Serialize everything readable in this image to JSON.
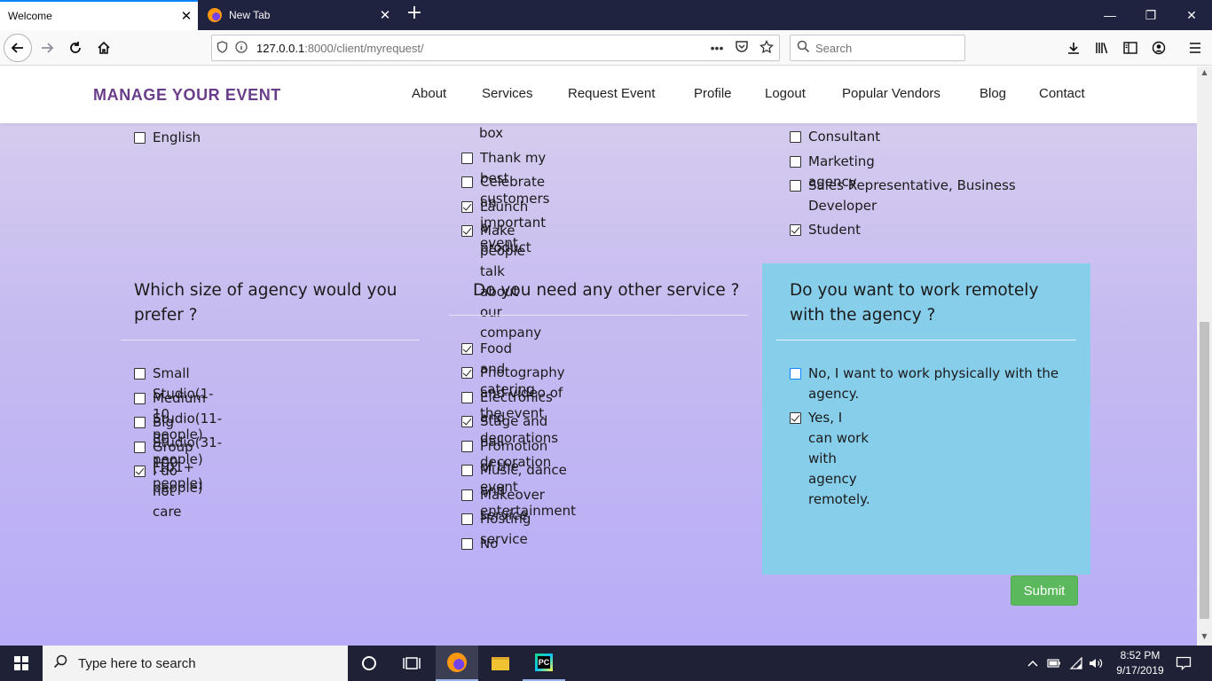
{
  "browser": {
    "tabs": [
      {
        "title": "Welcome",
        "close": "✕"
      },
      {
        "title": "New Tab",
        "close": "✕"
      }
    ],
    "new_tab": "+",
    "window_controls": {
      "minimize": "—",
      "restore": "❐",
      "close": "✕"
    },
    "url": {
      "host": "127.0.0.1",
      "rest": ":8000/client/myrequest/"
    },
    "url_more": "•••",
    "search_placeholder": "Search",
    "icons": {
      "back": "back-arrow-icon",
      "forward": "forward-arrow-icon",
      "reload": "reload-icon",
      "home": "home-icon"
    }
  },
  "site": {
    "brand": "MANAGE YOUR EVENT",
    "brand_color": "#6a3d8b",
    "menu": [
      "About",
      "Services",
      "Request Event",
      "Profile",
      "Logout",
      "Popular Vendors",
      "Blog",
      "Contact"
    ]
  },
  "form": {
    "languages_partial": [
      {
        "label": "English",
        "checked": false
      }
    ],
    "goals_partial": {
      "cut_text": "box",
      "options": [
        {
          "label": "Thank my best customers",
          "checked": false
        },
        {
          "label": "Celebrate an important event",
          "checked": false
        },
        {
          "label": "Launch a product",
          "checked": true
        },
        {
          "label": "Make people talk about our company",
          "checked": true
        }
      ]
    },
    "profession_partial": [
      {
        "label": "Consultant",
        "checked": false
      },
      {
        "label": "Marketing agency",
        "checked": false
      },
      {
        "label": "Sales Representative, Business Developer",
        "checked": false
      },
      {
        "label": "Student",
        "checked": true
      }
    ],
    "agency_size": {
      "question": "Which size of agency would you prefer ?",
      "options": [
        {
          "label": "Small Studio(1-10 people)",
          "checked": false
        },
        {
          "label": "Medium Studio(11-30 people)",
          "checked": false
        },
        {
          "label": "Big Studio(31-100 people)",
          "checked": false
        },
        {
          "label": "Group (101+ people)",
          "checked": false
        },
        {
          "label": "I do not care",
          "checked": true
        }
      ]
    },
    "other_service": {
      "question": "Do you need any other service ?",
      "options": [
        {
          "label": "Food and catering",
          "checked": true
        },
        {
          "label": "Photography and video of the event",
          "checked": true
        },
        {
          "label": "Electronics and decorations",
          "checked": false
        },
        {
          "label": "Stage and hall decoration",
          "checked": true
        },
        {
          "label": "Promotion of the event",
          "checked": false
        },
        {
          "label": "Music, dance and entertainment",
          "checked": false
        },
        {
          "label": "Makeover service",
          "checked": false
        },
        {
          "label": "Hosting service",
          "checked": false
        },
        {
          "label": "No",
          "checked": false
        }
      ]
    },
    "remote": {
      "question": "Do you want to work remotely with the agency ?",
      "box_color": "#87ceeb",
      "options": [
        {
          "label": "No, I want to work physically with the agency.",
          "checked": false
        },
        {
          "label": "Yes, I can work with agency remotely.",
          "checked": true
        }
      ]
    },
    "submit_label": "Submit",
    "submit_color": "#5cb85c"
  },
  "taskbar": {
    "search_placeholder": "Type here to search",
    "time": "8:52 PM",
    "date": "9/17/2019"
  }
}
